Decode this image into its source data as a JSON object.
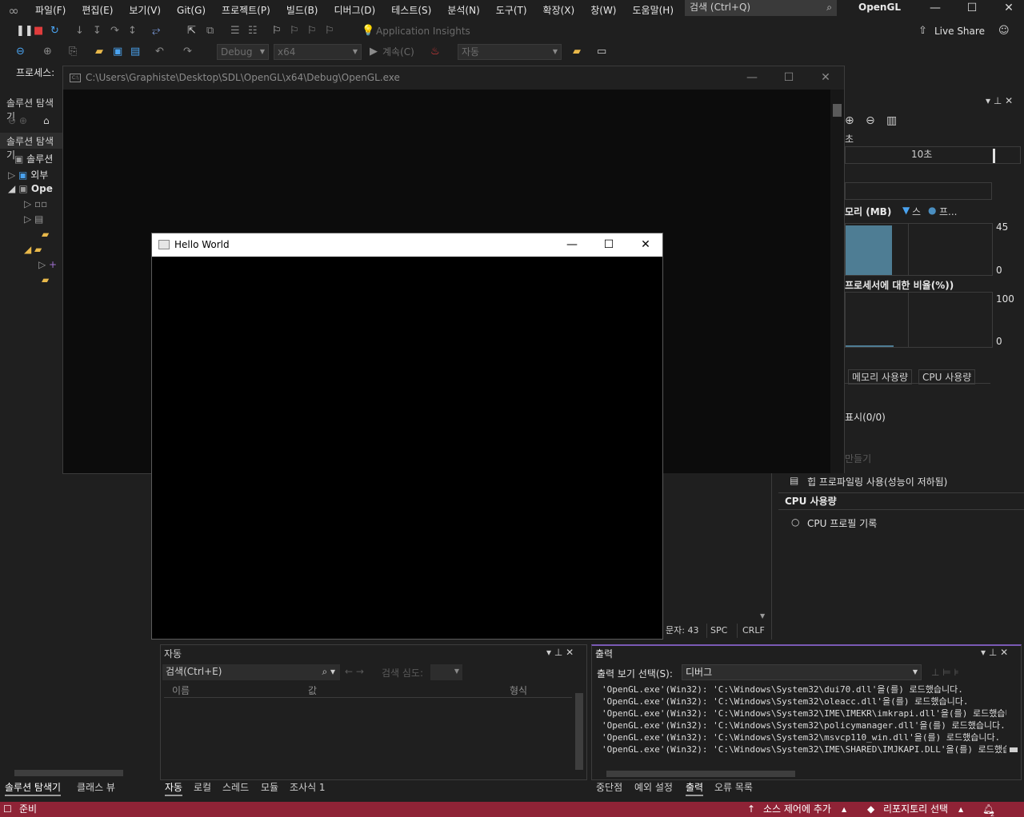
{
  "menu": {
    "items": [
      "파일(F)",
      "편집(E)",
      "보기(V)",
      "Git(G)",
      "프로젝트(P)",
      "빌드(B)",
      "디버그(D)",
      "테스트(S)",
      "분석(N)",
      "도구(T)",
      "확장(X)",
      "창(W)",
      "도움말(H)"
    ],
    "search_placeholder": "검색 (Ctrl+Q)",
    "solution_name": "OpenGL"
  },
  "toolbar": {
    "app_insights": "Application Insights",
    "live_share": "Live Share",
    "config": "Debug",
    "platform": "x64",
    "continue": "계속(C)",
    "auto_combo": "자동",
    "process_label": "프로세스:"
  },
  "console": {
    "title": "C:\\Users\\Graphiste\\Desktop\\SDL\\OpenGL\\x64\\Debug\\OpenGL.exe"
  },
  "hello": {
    "title": "Hello World"
  },
  "solution_explorer": {
    "tab1": "솔루션 탐색기",
    "tab2": "솔루션 탐색기",
    "solution": "솔루션",
    "external": "외부",
    "project": "Ope"
  },
  "diagnostics": {
    "seconds_short": "초",
    "seconds_label": "10초",
    "memory_label": "모리 (MB)",
    "legend_snapshot": "스",
    "legend_private": "프...",
    "mem_max": "45",
    "mem_min": "0",
    "cpu_label": "프로세서에 대한 비율(%))",
    "cpu_max": "100",
    "cpu_min": "0",
    "tab_memory": "메모리 사용량",
    "tab_cpu": "CPU 사용량",
    "snapshots": "표시(0/0)",
    "take_snapshot": "만들기",
    "heap_profiling": "힙 프로파일링 사용(성능이 저하됨)",
    "cpu_section": "CPU 사용량",
    "cpu_record": "CPU 프로필 기록"
  },
  "editor_status": {
    "chars": "문자: 43",
    "spc": "SPC",
    "crlf": "CRLF"
  },
  "autos": {
    "title": "자동",
    "search": "검색(Ctrl+E)",
    "search_depth": "검색 심도:",
    "col_name": "이름",
    "col_value": "값",
    "col_type": "형식",
    "tabs": [
      "자동",
      "로컬",
      "스레드",
      "모듈",
      "조사식 1"
    ]
  },
  "output": {
    "title": "출력",
    "show_from": "출력 보기 선택(S):",
    "source": "디버그",
    "lines": [
      "'OpenGL.exe'(Win32): 'C:\\Windows\\System32\\dui70.dll'을(를) 로드했습니다.",
      "'OpenGL.exe'(Win32): 'C:\\Windows\\System32\\oleacc.dll'을(를) 로드했습니다.",
      "'OpenGL.exe'(Win32): 'C:\\Windows\\System32\\IME\\IMEKR\\imkrapi.dll'을(를) 로드했습니다.",
      "'OpenGL.exe'(Win32): 'C:\\Windows\\System32\\policymanager.dll'을(를) 로드했습니다.",
      "'OpenGL.exe'(Win32): 'C:\\Windows\\System32\\msvcp110_win.dll'을(를) 로드했습니다.",
      "'OpenGL.exe'(Win32): 'C:\\Windows\\System32\\IME\\SHARED\\IMJKAPI.DLL'을(를) 로드했습니다."
    ],
    "tabs": [
      "중단점",
      "예외 설정",
      "출력",
      "오류 목록"
    ]
  },
  "left_tabs": [
    "솔루션 탐색기",
    "클래스 뷰"
  ],
  "statusbar": {
    "ready": "준비",
    "source_control": "소스 제어에 추가",
    "repo": "리포지토리 선택",
    "notifications": "2"
  },
  "colors": {
    "status": "#8f2336",
    "accent": "#68217a"
  }
}
